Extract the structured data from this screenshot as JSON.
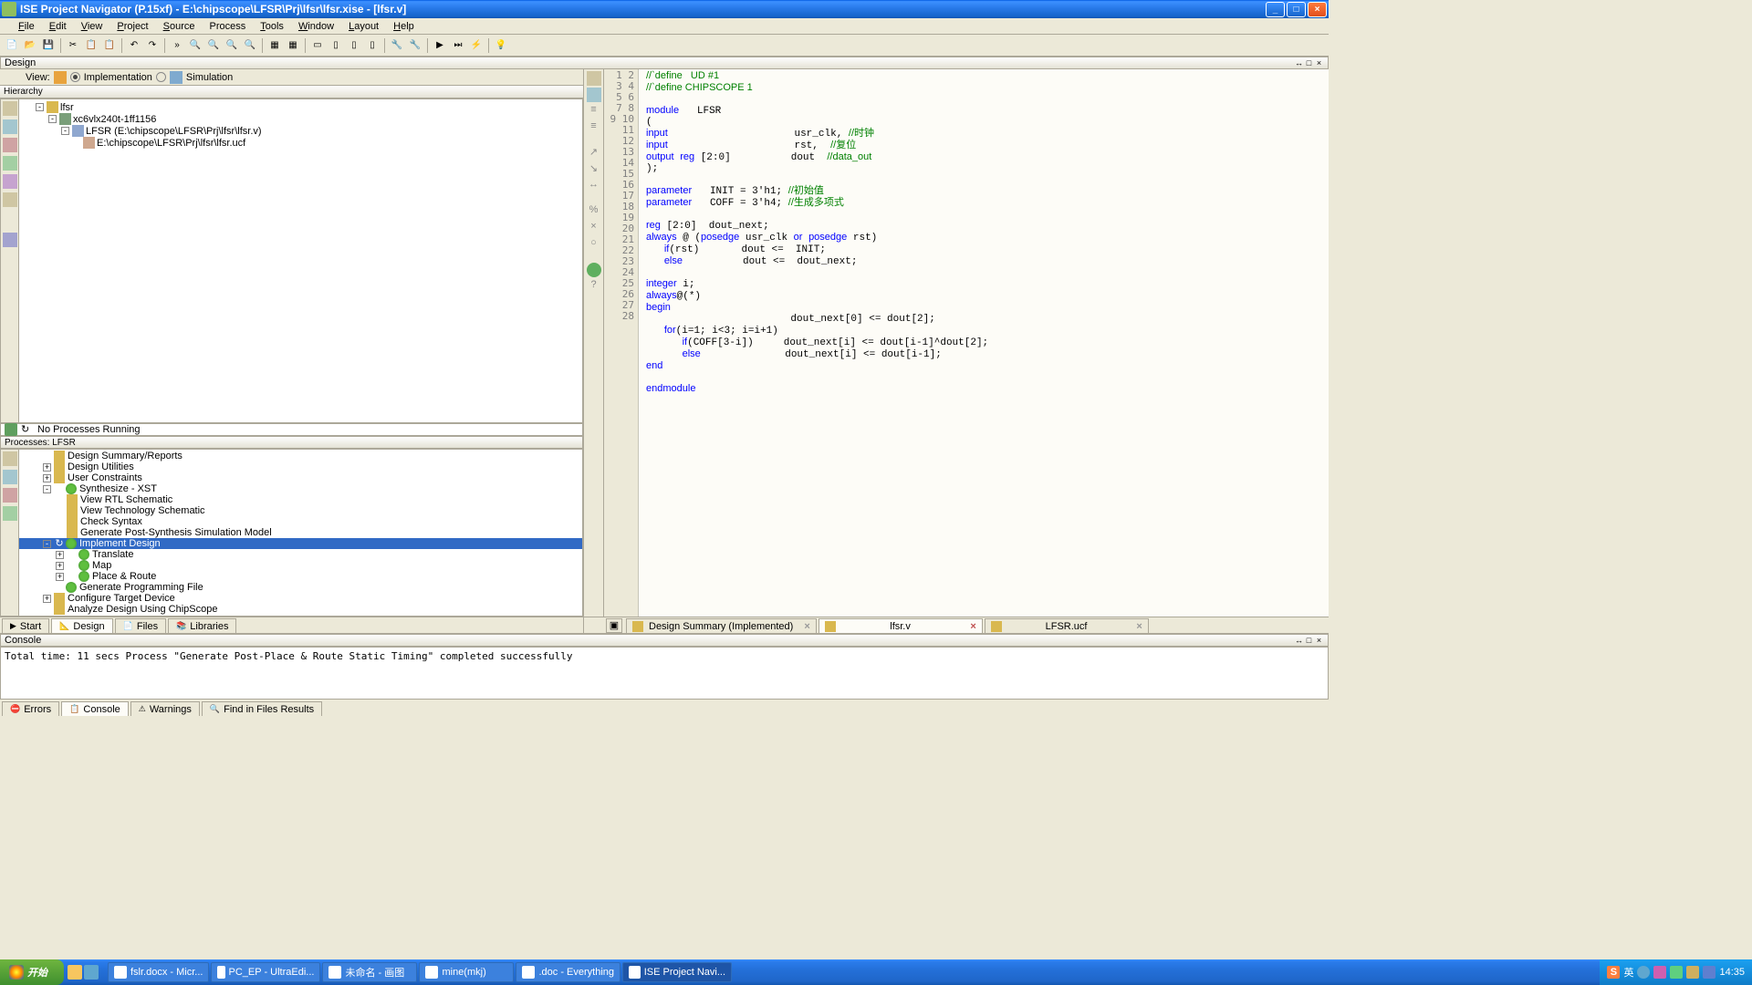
{
  "titlebar": {
    "text": "ISE Project Navigator (P.15xf) - E:\\chipscope\\LFSR\\Prj\\lfsr\\lfsr.xise - [lfsr.v]"
  },
  "menus": [
    "File",
    "Edit",
    "View",
    "Project",
    "Source",
    "Process",
    "Tools",
    "Window",
    "Layout",
    "Help"
  ],
  "menu_keys": [
    "F",
    "E",
    "V",
    "P",
    "S",
    "",
    "T",
    "W",
    "L",
    "H"
  ],
  "design_panel": {
    "title": "Design",
    "view_label": "View:",
    "impl": "Implementation",
    "sim": "Simulation",
    "hierarchy": "Hierarchy",
    "tree": {
      "root": "lfsr",
      "device": "xc6vlx240t-1ff1156",
      "module": "LFSR (E:\\chipscope\\LFSR\\Prj\\lfsr\\lfsr.v)",
      "ucf": "E:\\chipscope\\LFSR\\Prj\\lfsr\\lfsr.ucf"
    }
  },
  "proc_running": "No Processes Running",
  "proc_header": "Processes: LFSR",
  "processes": [
    {
      "ind": 1,
      "label": "Design Summary/Reports"
    },
    {
      "ind": 1,
      "exp": "+",
      "label": "Design Utilities"
    },
    {
      "ind": 1,
      "exp": "+",
      "label": "User Constraints"
    },
    {
      "ind": 1,
      "exp": "-",
      "status": "ok",
      "label": "Synthesize - XST"
    },
    {
      "ind": 2,
      "label": "View RTL Schematic"
    },
    {
      "ind": 2,
      "label": "View Technology Schematic"
    },
    {
      "ind": 2,
      "label": "Check Syntax"
    },
    {
      "ind": 2,
      "label": "Generate Post-Synthesis Simulation Model"
    },
    {
      "ind": 1,
      "exp": "-",
      "status": "ok",
      "label": "Implement Design",
      "sel": true
    },
    {
      "ind": 2,
      "exp": "+",
      "status": "ok",
      "label": "Translate"
    },
    {
      "ind": 2,
      "exp": "+",
      "status": "ok",
      "label": "Map"
    },
    {
      "ind": 2,
      "exp": "+",
      "status": "ok",
      "label": "Place & Route"
    },
    {
      "ind": 1,
      "status": "ok",
      "label": "Generate Programming File"
    },
    {
      "ind": 1,
      "exp": "+",
      "label": "Configure Target Device"
    },
    {
      "ind": 1,
      "label": "Analyze Design Using ChipScope"
    }
  ],
  "btm_tabs": [
    "Start",
    "Design",
    "Files",
    "Libraries"
  ],
  "btm_active": 1,
  "code": [
    {
      "n": 1,
      "h": "<span class='cm'>//`define   UD #1</span>"
    },
    {
      "n": 2,
      "h": "<span class='cm'>//`define CHIPSCOPE 1</span>"
    },
    {
      "n": 3,
      "h": ""
    },
    {
      "n": 4,
      "h": "<span class='kw'>module</span>   LFSR"
    },
    {
      "n": 5,
      "h": "("
    },
    {
      "n": 6,
      "h": "<span class='kw'>input</span>                     usr_clk, <span class='cm'>//时钟</span>"
    },
    {
      "n": 7,
      "h": "<span class='kw'>input</span>                     rst,  <span class='cm'>//复位</span>"
    },
    {
      "n": 8,
      "h": "<span class='kw'>output</span> <span class='kw'>reg</span> [2:0]          dout  <span class='cm'>//data_out</span>"
    },
    {
      "n": 9,
      "h": ");"
    },
    {
      "n": 10,
      "h": ""
    },
    {
      "n": 11,
      "h": "<span class='kw'>parameter</span>   INIT = 3'h1; <span class='cm'>//初始值</span>"
    },
    {
      "n": 12,
      "h": "<span class='kw'>parameter</span>   COFF = 3'h4; <span class='cm'>//生成多项式</span>"
    },
    {
      "n": 13,
      "h": ""
    },
    {
      "n": 14,
      "h": "<span class='kw'>reg</span> [2:0]  dout_next;"
    },
    {
      "n": 15,
      "h": "<span class='kw'>always</span> @ (<span class='kw'>posedge</span> usr_clk <span class='kw'>or</span> <span class='kw'>posedge</span> rst)"
    },
    {
      "n": 16,
      "h": "   <span class='kw'>if</span>(rst)       dout &lt;=  INIT;"
    },
    {
      "n": 17,
      "h": "   <span class='kw'>else</span>          dout &lt;=  dout_next;"
    },
    {
      "n": 18,
      "h": ""
    },
    {
      "n": 19,
      "h": "<span class='kw'>integer</span> i;"
    },
    {
      "n": 20,
      "h": "<span class='kw'>always</span>@(*)"
    },
    {
      "n": 21,
      "h": "<span class='kw'>begin</span>"
    },
    {
      "n": 22,
      "h": "                        dout_next[0] &lt;= dout[2];"
    },
    {
      "n": 23,
      "h": "   <span class='kw'>for</span>(i=1; i&lt;3; i=i+1)"
    },
    {
      "n": 24,
      "h": "      <span class='kw'>if</span>(COFF[3-i])     dout_next[i] &lt;= dout[i-1]^dout[2];"
    },
    {
      "n": 25,
      "h": "      <span class='kw'>else</span>              dout_next[i] &lt;= dout[i-1];"
    },
    {
      "n": 26,
      "h": "<span class='kw'>end</span>"
    },
    {
      "n": 27,
      "h": ""
    },
    {
      "n": 28,
      "h": "<span class='kw'>endmodule</span>"
    }
  ],
  "ed_tabs": [
    {
      "label": "Design Summary (Implemented)",
      "active": false
    },
    {
      "label": "lfsr.v",
      "active": true
    },
    {
      "label": "LFSR.ucf",
      "active": false
    }
  ],
  "console": {
    "title": "Console",
    "body": "Total time: 11 secs\n\nProcess \"Generate Post-Place & Route Static Timing\" completed successfully"
  },
  "console_tabs": [
    "Errors",
    "Console",
    "Warnings",
    "Find in Files Results"
  ],
  "console_active": 1,
  "taskbar": {
    "start": "开始",
    "tasks": [
      {
        "label": "fslr.docx - Micr..."
      },
      {
        "label": "PC_EP - UltraEdi..."
      },
      {
        "label": "未命名 - 画图"
      },
      {
        "label": "mine(mkj)"
      },
      {
        "label": ".doc - Everything"
      },
      {
        "label": "ISE Project Navi...",
        "active": true
      }
    ],
    "lang": "英",
    "time": "14:35"
  }
}
